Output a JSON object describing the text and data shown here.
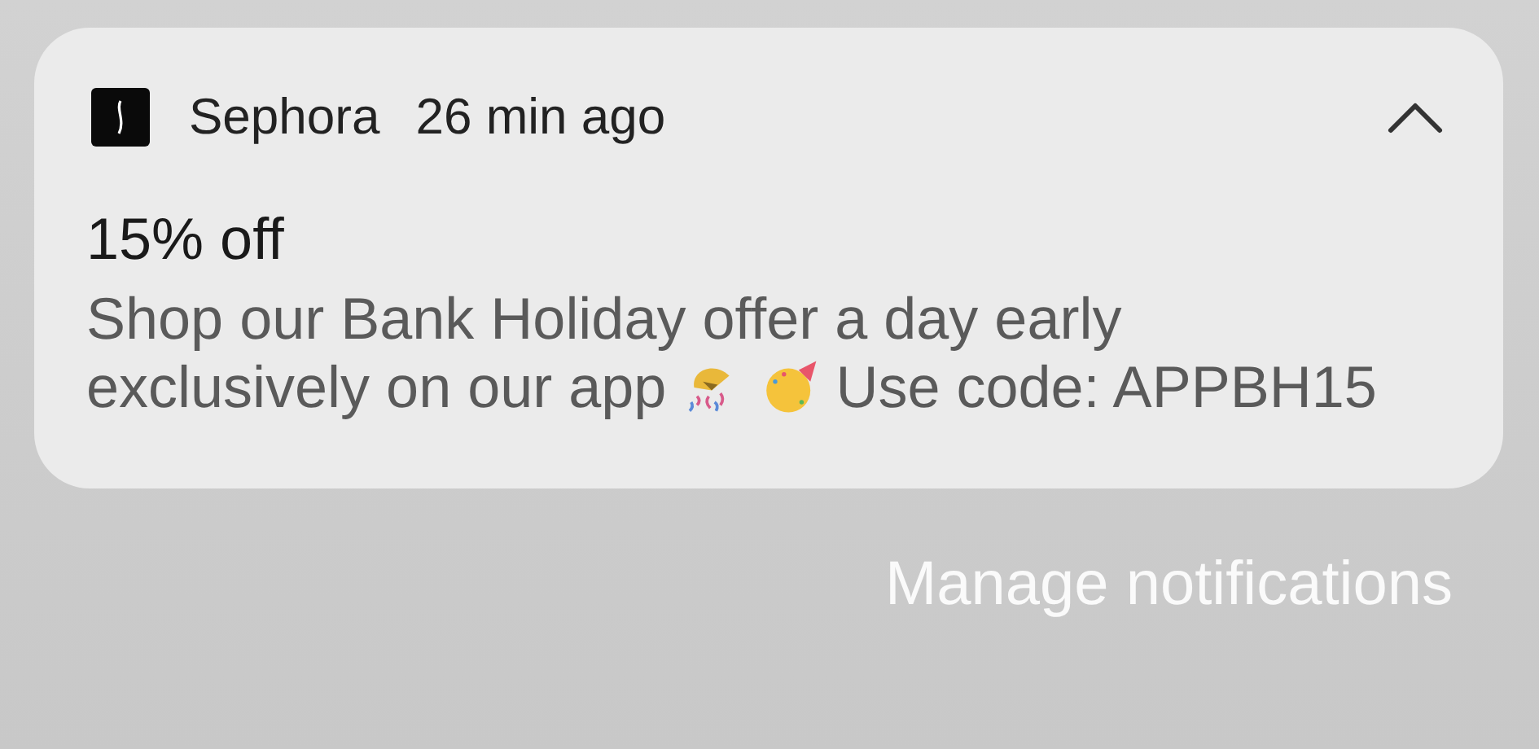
{
  "notification": {
    "app_name": "Sephora",
    "time": "26 min ago",
    "expanded": true,
    "title": "15% off",
    "body_lines": [
      "Shop our Bank Holiday offer a day early",
      "exclusively on our app"
    ],
    "body_end": "Use code: APPBH15"
  },
  "manage_link": "Manage notifications"
}
